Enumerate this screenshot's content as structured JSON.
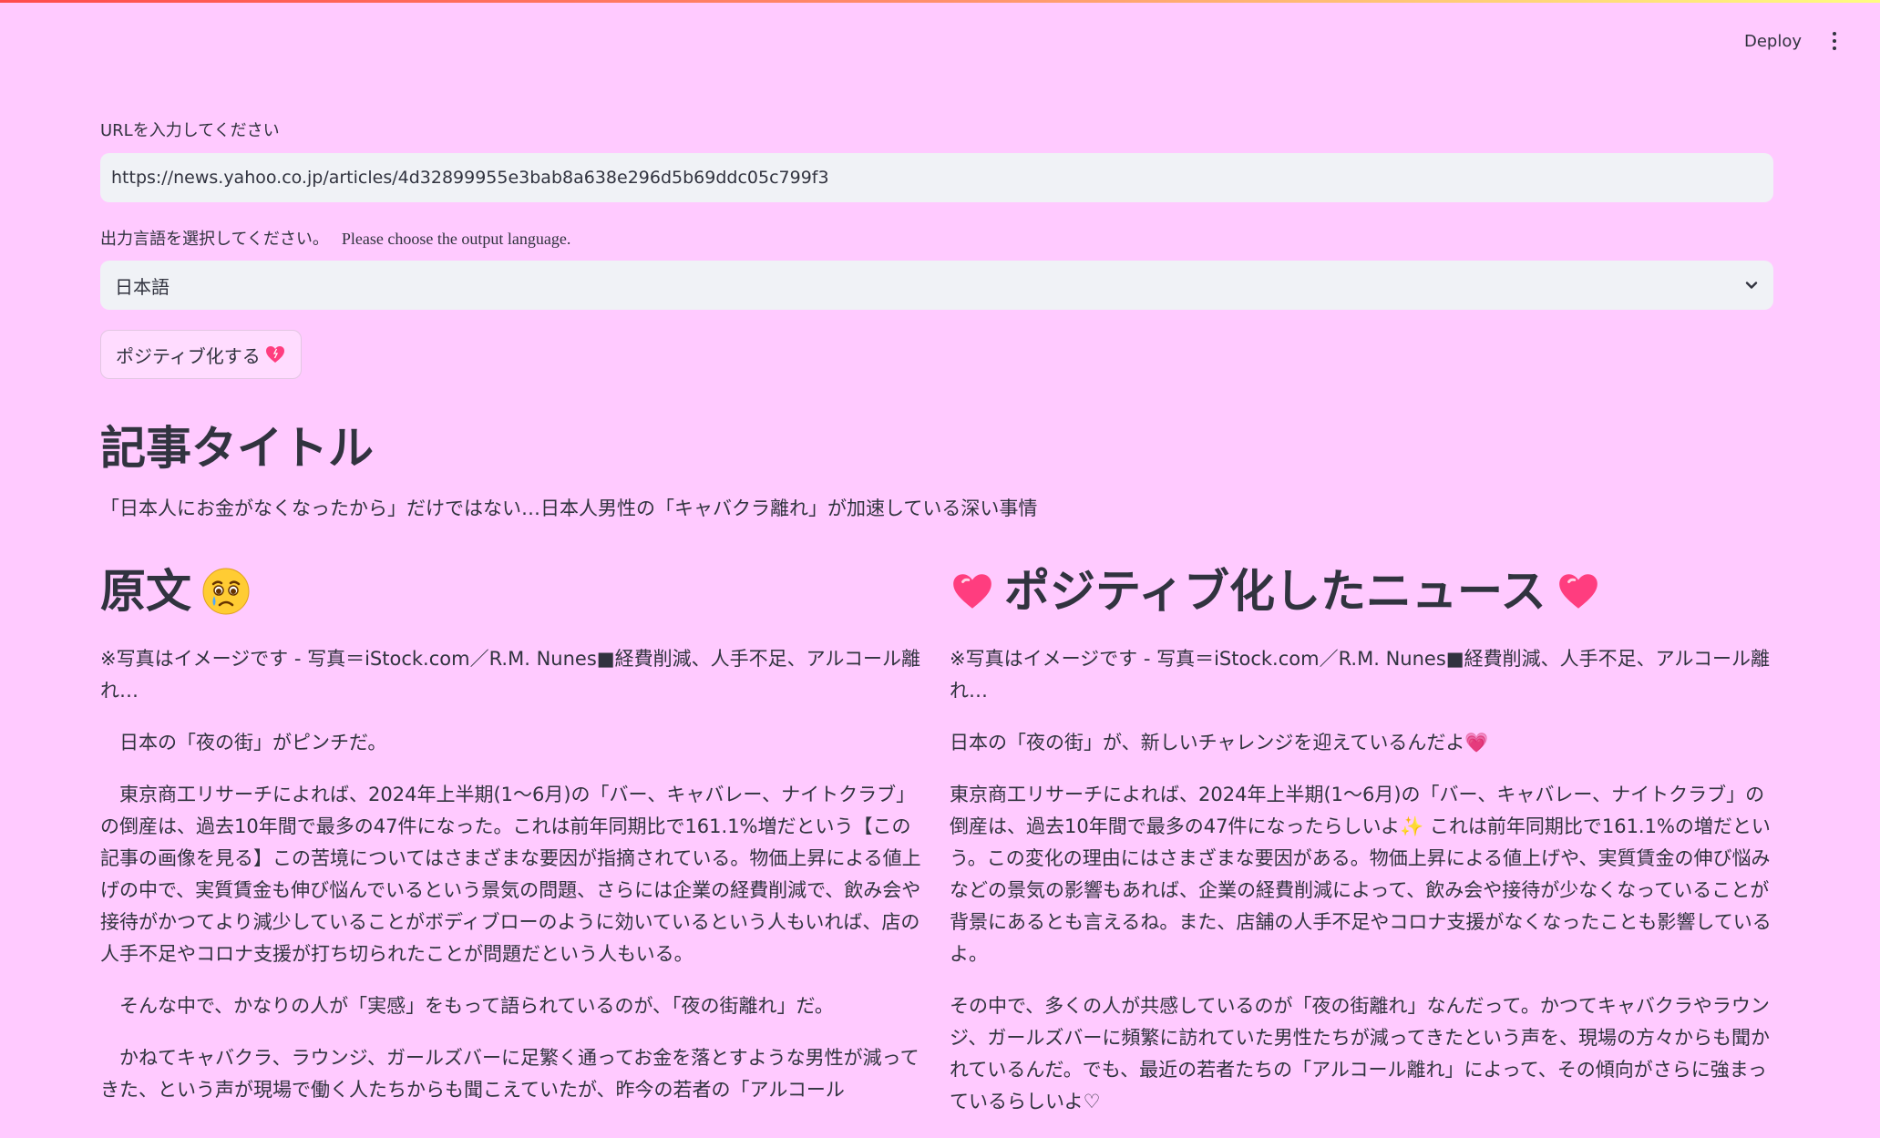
{
  "header": {
    "deploy_label": "Deploy"
  },
  "url_input": {
    "label": "URLを入力してください",
    "value": "https://news.yahoo.co.jp/articles/4d32899955e3bab8a638e296d5b69ddc05c799f3"
  },
  "language_select": {
    "label_ja": "出力言語を選択してください。",
    "label_en": "Please choose the output language.",
    "selected": "日本語"
  },
  "positive_button": {
    "label": "ポジティブ化する"
  },
  "article": {
    "heading": "記事タイトル",
    "title": "「日本人にお金がなくなったから」だけではない…日本人男性の「キャバクラ離れ」が加速している深い事情"
  },
  "original": {
    "heading": "原文",
    "paragraphs": [
      "※写真はイメージです - 写真＝iStock.com／R.M. Nunes■経費削減、人手不足、アルコール離れ…",
      "　日本の「夜の街」がピンチだ。",
      "　東京商工リサーチによれば、2024年上半期(1～6月)の「バー、キャバレー、ナイトクラブ」の倒産は、過去10年間で最多の47件になった。これは前年同期比で161.1%増だという【この記事の画像を見る】この苦境についてはさまざまな要因が指摘されている。物価上昇による値上げの中で、実質賃金も伸び悩んでいるという景気の問題、さらには企業の経費削減で、飲み会や接待がかつてより減少していることがボディブローのように効いているという人もいれば、店の人手不足やコロナ支援が打ち切られたことが問題だという人もいる。",
      "　そんな中で、かなりの人が「実感」をもって語られているのが、「夜の街離れ」だ。",
      "　かねてキャバクラ、ラウンジ、ガールズバーに足繁く通ってお金を落とすような男性が減ってきた、という声が現場で働く人たちからも聞こえていたが、昨今の若者の「アルコール"
    ]
  },
  "positive": {
    "heading": "ポジティブ化したニュース",
    "paragraphs": [
      "※写真はイメージです - 写真＝iStock.com／R.M. Nunes■経費削減、人手不足、アルコール離れ…",
      "日本の「夜の街」が、新しいチャレンジを迎えているんだよ💗",
      "東京商工リサーチによれば、2024年上半期(1～6月)の「バー、キャバレー、ナイトクラブ」の倒産は、過去10年間で最多の47件になったらしいよ✨ これは前年同期比で161.1%の増だという。この変化の理由にはさまざまな要因がある。物価上昇による値上げや、実質賃金の伸び悩みなどの景気の影響もあれば、企業の経費削減によって、飲み会や接待が少なくなっていることが背景にあるとも言えるね。また、店舗の人手不足やコロナ支援がなくなったことも影響しているよ。",
      "その中で、多くの人が共感しているのが「夜の街離れ」なんだって。かつてキャバクラやラウンジ、ガールズバーに頻繁に訪れていた男性たちが減ってきたという声を、現場の方々からも聞かれているんだ。でも、最近の若者たちの「アルコール離れ」によって、その傾向がさらに強まっているらしいよ♡"
    ]
  },
  "colors": {
    "background": "#ffcaff",
    "input_bg": "#f0f2f6",
    "heart": "#ff3d7f"
  }
}
